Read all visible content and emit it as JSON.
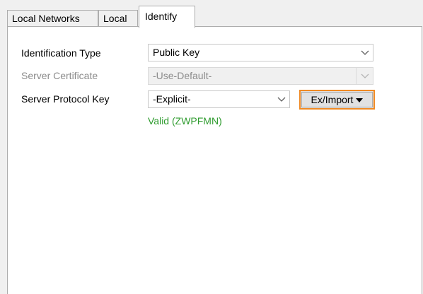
{
  "tabs": [
    {
      "label": "Local Networks"
    },
    {
      "label": "Local"
    },
    {
      "label": "Identify"
    }
  ],
  "form": {
    "identification_type": {
      "label": "Identification Type",
      "value": "Public Key"
    },
    "server_certificate": {
      "label": "Server Certificate",
      "value": "-Use-Default-"
    },
    "server_protocol_key": {
      "label": "Server Protocol Key",
      "value": "-Explicit-"
    },
    "ex_import_button": {
      "label": "Ex/Import"
    },
    "status": "Valid (ZWPFMN)"
  },
  "icons": {
    "combo_arrow": "chevron-down-icon",
    "button_arrow": "triangle-down-icon"
  },
  "colors": {
    "focus_border": "#f08a24",
    "status_valid": "#2e9b2e",
    "disabled_text": "#8c8c8c"
  }
}
